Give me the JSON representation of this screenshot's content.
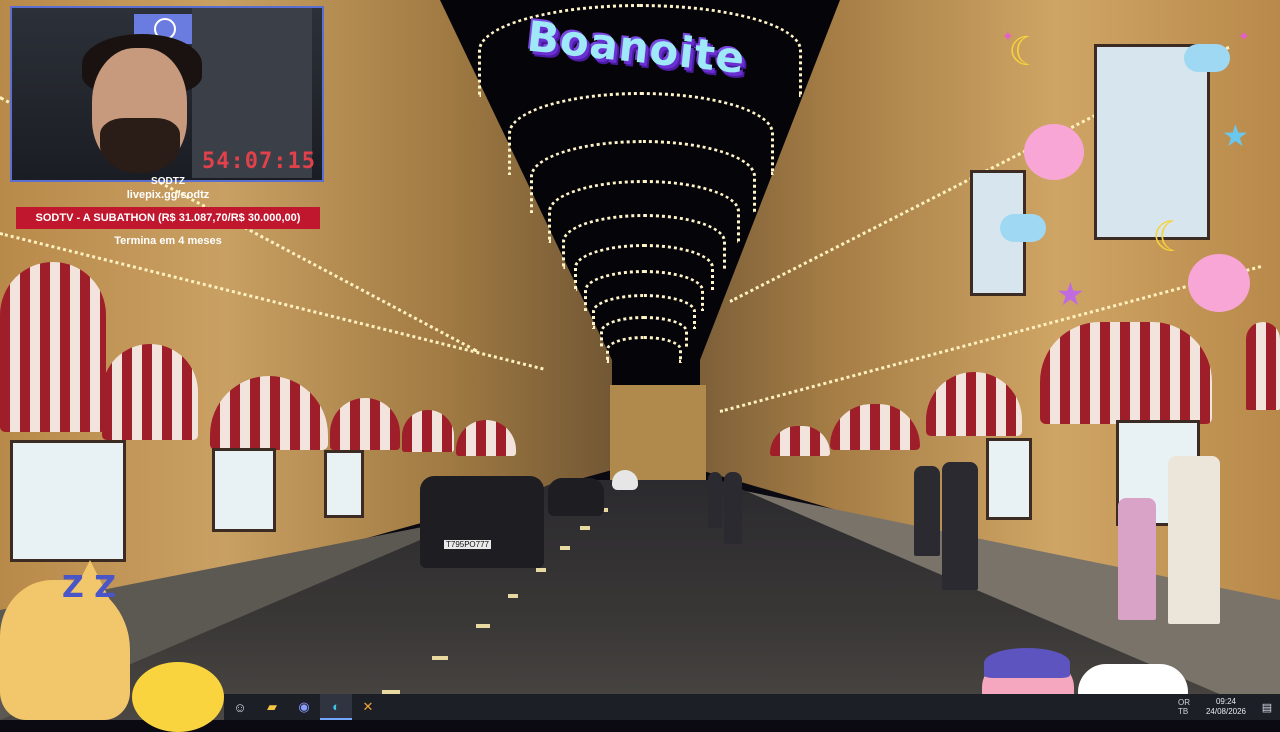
{
  "stream": {
    "timer": "54:07:15",
    "channel_small": "SODTZ",
    "link": "livepix.gg/sodtz",
    "subathon": "SODTV - A SUBATHON (R$ 31.087,70/R$ 30.000,00)",
    "ends_in": "Termina em 4 meses"
  },
  "banner": {
    "text": "Boanoite"
  },
  "scene": {
    "plate": "Т795РО777"
  },
  "emotes": {
    "zz": "Z Z"
  },
  "taskbar": {
    "icons": [
      {
        "name": "emoji-app-icon",
        "glyph": "☺"
      },
      {
        "name": "file-explorer-icon",
        "glyph": "▰"
      },
      {
        "name": "discord-icon",
        "glyph": "◉"
      },
      {
        "name": "edge-browser-icon",
        "glyph": "◐"
      },
      {
        "name": "obs-app-icon",
        "glyph": "✕"
      }
    ],
    "lang_top": "OR",
    "lang_bottom": "TB",
    "time": "09:24",
    "date": "24/08/2026"
  },
  "colors": {
    "subathon_bar": "#c0172e",
    "timer": "#e0414a",
    "webcam_border": "#5a6fd0"
  }
}
